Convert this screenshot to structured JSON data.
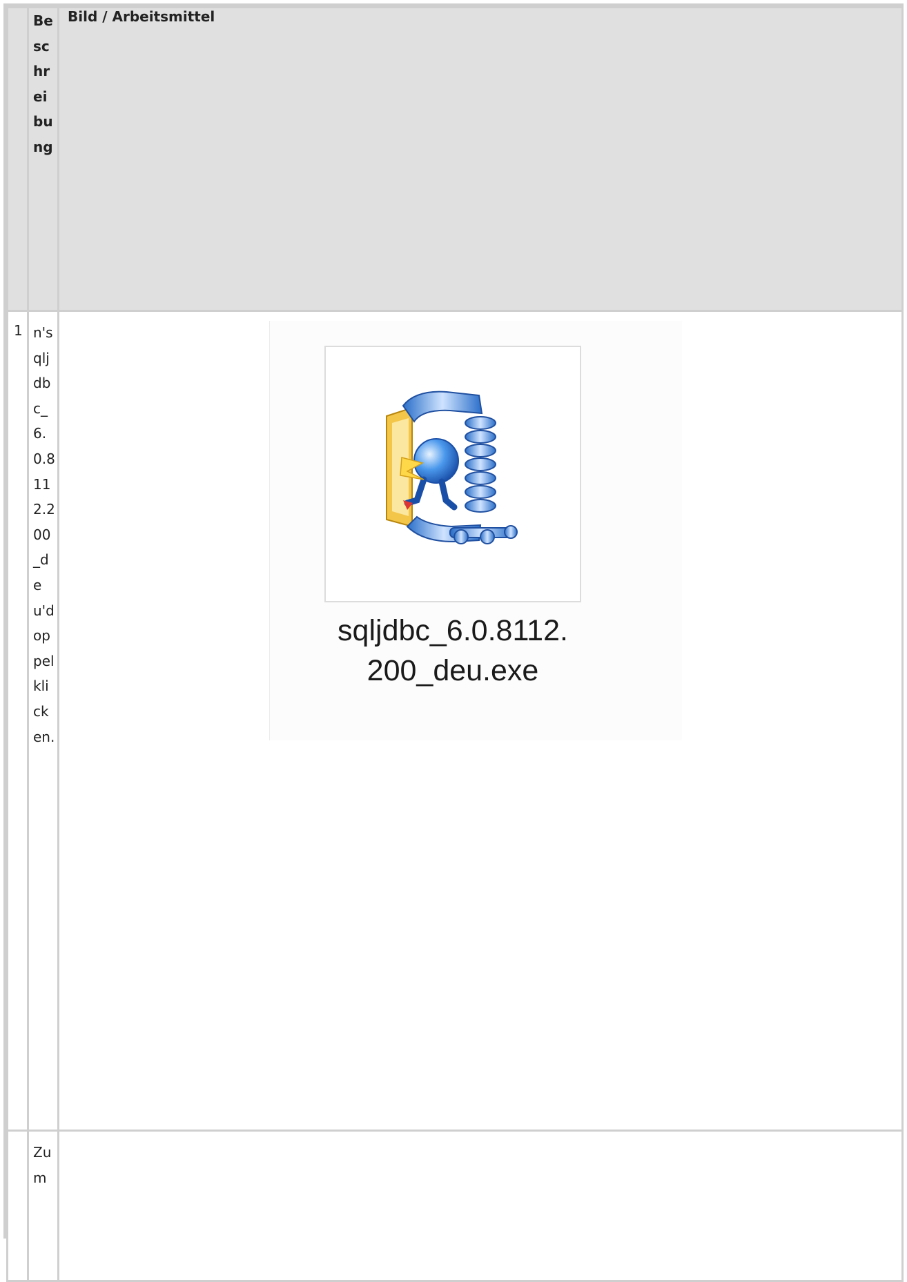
{
  "table": {
    "header": {
      "num": "",
      "description": "Beschreibung",
      "image": "Bild / Arbeitsmittel"
    },
    "rows": [
      {
        "num": "1",
        "description": "n'sqljdbc_6.0.8112.200_deu'doppelklicken.",
        "image": {
          "icon": "winzip-self-extractor-icon",
          "file_label": "sqljdbc_6.0.8112.\n200_deu.exe"
        }
      },
      {
        "num": "",
        "description": "Zum"
      }
    ]
  }
}
